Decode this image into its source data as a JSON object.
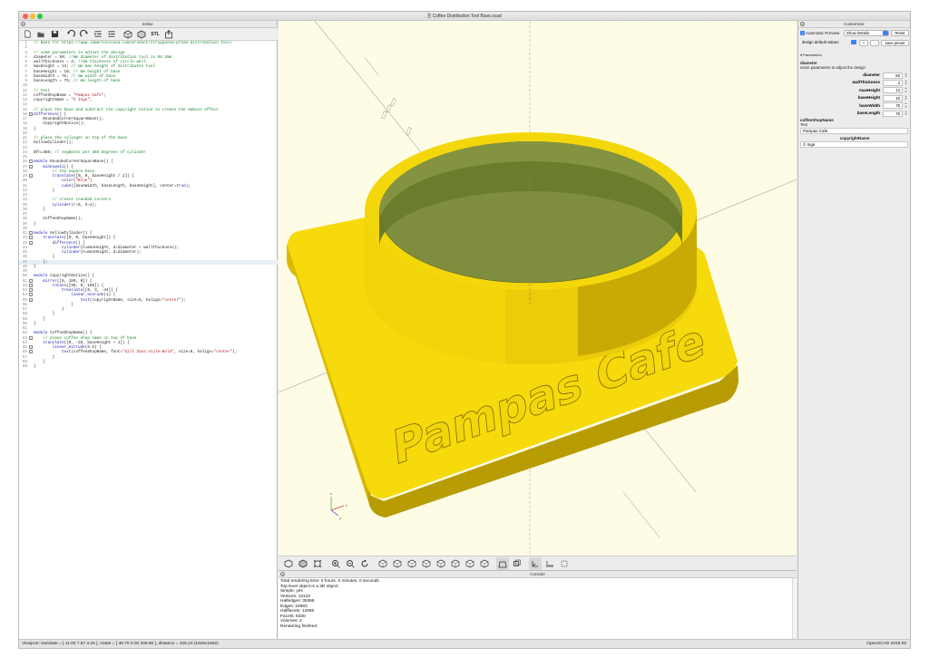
{
  "window": {
    "title": "Coffee Distribution Tool Base.scad",
    "colors": {
      "close": "#ff5f57",
      "minimize": "#febc2e",
      "zoom": "#28c840"
    }
  },
  "editor": {
    "title": "Editor",
    "toolbar": [
      "new-icon",
      "open-icon",
      "save-icon",
      "undo-icon",
      "redo-icon",
      "indent-icon",
      "unindent-icon",
      "preview-icon",
      "render-icon",
      "export-stl-icon",
      "send-icon"
    ],
    "toolbar_text": {
      "stl": "STL"
    },
    "highlight_line": 47,
    "lines": [
      [
        {
          "c": "cm",
          "t": "// Base for https://www.lamarzoccousa.com/product/strippassa-primo-distribution-tool/"
        }
      ],
      [],
      [
        {
          "c": "cm",
          "t": "// some parameters to adjust the design"
        }
      ],
      [
        {
          "t": "diameter = 50; "
        },
        {
          "c": "cm",
          "t": "//mm diameter of distribution tool is 58.3mm"
        }
      ],
      [
        {
          "t": "wallThickness = 4; "
        },
        {
          "c": "cm",
          "t": "//mm thickness of circle wall"
        }
      ],
      [
        {
          "t": "maxHeight = 13; "
        },
        {
          "c": "cm",
          "t": "// mm max height of distributes tool"
        }
      ],
      [
        {
          "t": "baseHeight = 10; "
        },
        {
          "c": "cm",
          "t": "// mm height of base"
        }
      ],
      [
        {
          "t": "baseWidth = 75; "
        },
        {
          "c": "cm",
          "t": "// mm width of base"
        }
      ],
      [
        {
          "t": "baseLength = 75; "
        },
        {
          "c": "cm",
          "t": "// mm length of base"
        }
      ],
      [],
      [
        {
          "c": "cm",
          "t": "// Text"
        }
      ],
      [
        {
          "t": "coffeeShopName = "
        },
        {
          "c": "st",
          "t": "\"Pampas Cafe\""
        },
        {
          "t": ";"
        }
      ],
      [
        {
          "t": "copyrightName = "
        },
        {
          "c": "st",
          "t": "\"© Inge\""
        },
        {
          "t": ";"
        }
      ],
      [],
      [
        {
          "c": "cm",
          "t": "// place the base and subtract the copyright notice to create the emboss effect"
        }
      ],
      [
        {
          "c": "kw",
          "t": "difference"
        },
        {
          "t": "() {"
        }
      ],
      [
        {
          "t": "    RoundedCornerSquareBase();"
        }
      ],
      [
        {
          "t": "    CopyrightNotice();"
        }
      ],
      [
        {
          "t": "}"
        }
      ],
      [],
      [
        {
          "c": "cm",
          "t": "// place the cylinger on top of the base"
        }
      ],
      [
        {
          "t": "HollowCylinder();"
        }
      ],
      [],
      [
        {
          "t": "$fn=360; "
        },
        {
          "c": "cm",
          "t": "// segments per 360 degrees of cylinder"
        }
      ],
      [],
      [
        {
          "c": "kw",
          "t": "module"
        },
        {
          "t": " RoundedCornerSquareBase() {"
        }
      ],
      [
        {
          "t": "    "
        },
        {
          "c": "kw",
          "t": "minkowski"
        },
        {
          "t": "() {"
        }
      ],
      [
        {
          "t": "        "
        },
        {
          "c": "cm",
          "t": "// the square base"
        }
      ],
      [
        {
          "t": "        "
        },
        {
          "c": "kw",
          "t": "translate"
        },
        {
          "t": "([0, 0, baseHeight / 2]) {"
        }
      ],
      [
        {
          "t": "            "
        },
        {
          "c": "kw",
          "t": "color"
        },
        {
          "t": "("
        },
        {
          "c": "st",
          "t": "\"Blue\""
        },
        {
          "t": ")"
        }
      ],
      [
        {
          "t": "            "
        },
        {
          "c": "kw",
          "t": "cube"
        },
        {
          "t": "([baseWidth, baseLength, baseHeight], center="
        },
        {
          "c": "kw",
          "t": "true"
        },
        {
          "t": ");"
        }
      ],
      [
        {
          "t": "        }"
        }
      ],
      [],
      [
        {
          "t": "        "
        },
        {
          "c": "cm",
          "t": "// create rounded corners"
        }
      ],
      [
        {
          "t": "        "
        },
        {
          "c": "kw",
          "t": "cylinder"
        },
        {
          "t": "(r=5, h=1);"
        }
      ],
      [
        {
          "t": "    }"
        }
      ],
      [],
      [
        {
          "t": "    CoffeeShopName();"
        }
      ],
      [
        {
          "t": "}"
        }
      ],
      [],
      [
        {
          "c": "kw",
          "t": "module"
        },
        {
          "t": " HollowCylinder() {"
        }
      ],
      [
        {
          "t": "    "
        },
        {
          "c": "kw",
          "t": "translate"
        },
        {
          "t": "([0, 0, baseHeight]) {"
        }
      ],
      [
        {
          "t": "        "
        },
        {
          "c": "kw",
          "t": "difference"
        },
        {
          "t": "() {"
        }
      ],
      [
        {
          "t": "            "
        },
        {
          "c": "kw",
          "t": "cylinder"
        },
        {
          "t": "(h=maxHeight, d=diameter + wallThickness);"
        }
      ],
      [
        {
          "t": "            "
        },
        {
          "c": "kw",
          "t": "cylinder"
        },
        {
          "t": "(h=maxHeight, d=diameter);"
        }
      ],
      [
        {
          "t": "        }"
        }
      ],
      [
        {
          "t": "    };"
        }
      ],
      [
        {
          "t": "}"
        }
      ],
      [],
      [
        {
          "c": "kw",
          "t": "module"
        },
        {
          "t": " CopyrightNotice() {"
        }
      ],
      [
        {
          "t": "    "
        },
        {
          "c": "kw",
          "t": "mirror"
        },
        {
          "t": "([0, 180, 0]) {"
        }
      ],
      [
        {
          "t": "        "
        },
        {
          "c": "kw",
          "t": "rotate"
        },
        {
          "t": "([90, 0, 180]) {"
        }
      ],
      [
        {
          "t": "            "
        },
        {
          "c": "kw",
          "t": "translate"
        },
        {
          "t": "([0, 3, -44]) {"
        }
      ],
      [
        {
          "t": "                "
        },
        {
          "c": "kw",
          "t": "linear_extrude"
        },
        {
          "t": "(1) {"
        }
      ],
      [
        {
          "t": "                    "
        },
        {
          "c": "kw",
          "t": "text"
        },
        {
          "t": "(copyrightName, size=5, halign="
        },
        {
          "c": "st",
          "t": "\"center\""
        },
        {
          "t": ");"
        }
      ],
      [
        {
          "t": "                }"
        }
      ],
      [
        {
          "t": "            }"
        }
      ],
      [
        {
          "t": "        }"
        }
      ],
      [
        {
          "t": "    }"
        }
      ],
      [
        {
          "t": "}"
        }
      ],
      [],
      [
        {
          "c": "kw",
          "t": "module"
        },
        {
          "t": " CoffeeShopName() {"
        }
      ],
      [
        {
          "t": "    "
        },
        {
          "c": "cm",
          "t": "// place coffee shop name on top of base"
        }
      ],
      [
        {
          "t": "    "
        },
        {
          "c": "kw",
          "t": "translate"
        },
        {
          "t": "([0, -20, baseHeight + 1]) {"
        }
      ],
      [
        {
          "t": "        "
        },
        {
          "c": "kw",
          "t": "linear_extrude"
        },
        {
          "t": "(0.5) {"
        }
      ],
      [
        {
          "t": "            "
        },
        {
          "c": "kw",
          "t": "text"
        },
        {
          "t": "(coffeeShopName, font="
        },
        {
          "c": "st",
          "t": "\"Gill Sans:style=Bold\""
        },
        {
          "t": ", size=9, halign="
        },
        {
          "c": "st",
          "t": "\"center\""
        },
        {
          "t": ");"
        }
      ],
      [
        {
          "t": "        }"
        }
      ],
      [
        {
          "t": "    }"
        }
      ],
      [
        {
          "t": "}"
        }
      ]
    ],
    "fold_lines": [
      16,
      26,
      27,
      29,
      41,
      42,
      43,
      51,
      52,
      53,
      54,
      55,
      63,
      65,
      66
    ]
  },
  "viewport": {
    "model_text": "Pampas Cafe",
    "model_color": "#f4d70a",
    "background": "#fffce5"
  },
  "view_toolbar": [
    "preview-icon",
    "render-icon",
    "view-all-icon",
    "zoom-in-icon",
    "zoom-out-icon",
    "reset-view-icon",
    "view-right-icon",
    "view-top-icon",
    "view-bottom-icon",
    "view-left-icon",
    "view-front-icon",
    "view-back-icon",
    "view-diagonal-icon",
    "view-center-icon",
    "perspective-icon",
    "orthogonal-icon",
    "show-axes-icon",
    "show-scale-icon",
    "show-edges-icon"
  ],
  "active_view_tools": [
    "perspective-icon",
    "show-axes-icon"
  ],
  "console": {
    "title": "Console",
    "lines": [
      "Total rendering time: 0 hours, 0 minutes, 0 seconds",
      "Top level object is a 3D object:",
      "Simple: yes",
      "Vertices: 13122",
      "Halfedges: 39366",
      "Edges: 19683",
      "Halffacets: 12690",
      "Facets: 6330",
      "Volumes: 2",
      "Rendering finished."
    ]
  },
  "customizer": {
    "title": "Customizer",
    "auto_preview_label": "Automatic Preview",
    "auto_preview_checked": true,
    "detail_select": "Show Details",
    "reset_label": "Reset",
    "preset_select": "design default values",
    "add_label": "+",
    "remove_label": "-",
    "save_preset_label": "save preset",
    "section_label": "Parameters",
    "diameter_label": "diameter",
    "diameter_desc": "some parameters to adjust the design",
    "params": [
      {
        "label": "diameter",
        "value": "50"
      },
      {
        "label": "wallThickness",
        "value": "4"
      },
      {
        "label": "maxHeight",
        "value": "13"
      },
      {
        "label": "baseHeight",
        "value": "10"
      },
      {
        "label": "baseWidth",
        "value": "75"
      },
      {
        "label": "baseLength",
        "value": "75"
      }
    ],
    "coffee_label": "coffeeShopName",
    "coffee_desc": "Text",
    "coffee_value": "Pampas Cafe",
    "copyright_label": "copyrightName",
    "copyright_value": "© Inge"
  },
  "status": {
    "viewport": "Viewport: translate = [ 11.00 7.67 3.26 ], rotate = [ 48.70 0.00 336.60 ], distance = 326.23 (1625x1682)",
    "version": "OpenSCAD 2019.05"
  }
}
